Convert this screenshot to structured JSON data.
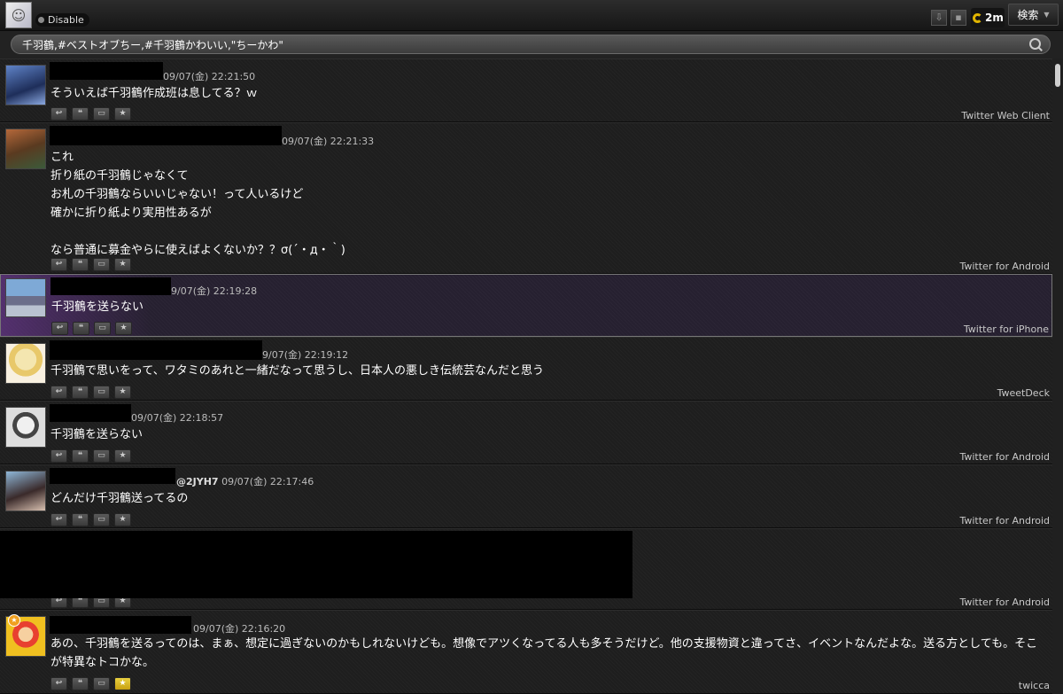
{
  "topbar": {
    "disable_label": "Disable",
    "refresh_label": "2m",
    "search_menu_label": "検索"
  },
  "search": {
    "query": "千羽鶴,#ベストオブちー,#千羽鶴かわいい,\"ちーかわ\""
  },
  "tweets": [
    {
      "time": "09/07(金) 22:21:50",
      "screen_name": "",
      "text": "そういえば千羽鶴作成班は息してる？ｗ",
      "source": "Twitter Web Client"
    },
    {
      "time": "09/07(金) 22:21:33",
      "screen_name": "",
      "text": "これ\n折り紙の千羽鶴じゃなくて\nお札の千羽鶴ならいいじゃない！って人いるけど\n確かに折り紙より実用性あるが\n\nなら普通に募金やらに使えばよくないか？？σ(´・д・｀)",
      "source": "Twitter for Android"
    },
    {
      "time": "9/07(金) 22:19:28",
      "screen_name": "",
      "text": "千羽鶴を送らない",
      "source": "Twitter for iPhone"
    },
    {
      "time": "9/07(金) 22:19:12",
      "screen_name": "",
      "text": "千羽鶴で思いをって、ワタミのあれと一緒だなって思うし、日本人の悪しき伝統芸なんだと思う",
      "source": "TweetDeck"
    },
    {
      "time": "09/07(金) 22:18:57",
      "screen_name": "",
      "text": "千羽鶴を送らない",
      "source": "Twitter for Android"
    },
    {
      "time": "09/07(金) 22:17:46",
      "screen_name": "@2JYH7",
      "text": "どんだけ千羽鶴送ってるの",
      "source": "Twitter for Android"
    },
    {
      "time": "",
      "screen_name": "",
      "text": "",
      "source": "Twitter for Android"
    },
    {
      "time": "09/07(金) 22:16:20",
      "screen_name": "",
      "text": "あの、千羽鶴を送るってのは、まぁ、想定に過ぎないのかもしれないけども。想像でアツくなってる人も多そうだけど。他の支援物資と違ってさ、イベントなんだよな。送る方としても。そこが特異なトコかな。",
      "source": "twicca"
    }
  ],
  "colors": {
    "background": "#1b1b1b",
    "text": "#ffffff",
    "meta": "#bbbbbb",
    "favorite_on": "#e8c020",
    "refresh_ring": "#e0b400"
  },
  "icons": [
    "reply-icon",
    "quote-icon",
    "retweet-icon",
    "favorite-icon",
    "search-icon",
    "download-icon",
    "lock-icon",
    "refresh-icon",
    "dropdown-caret-icon"
  ]
}
